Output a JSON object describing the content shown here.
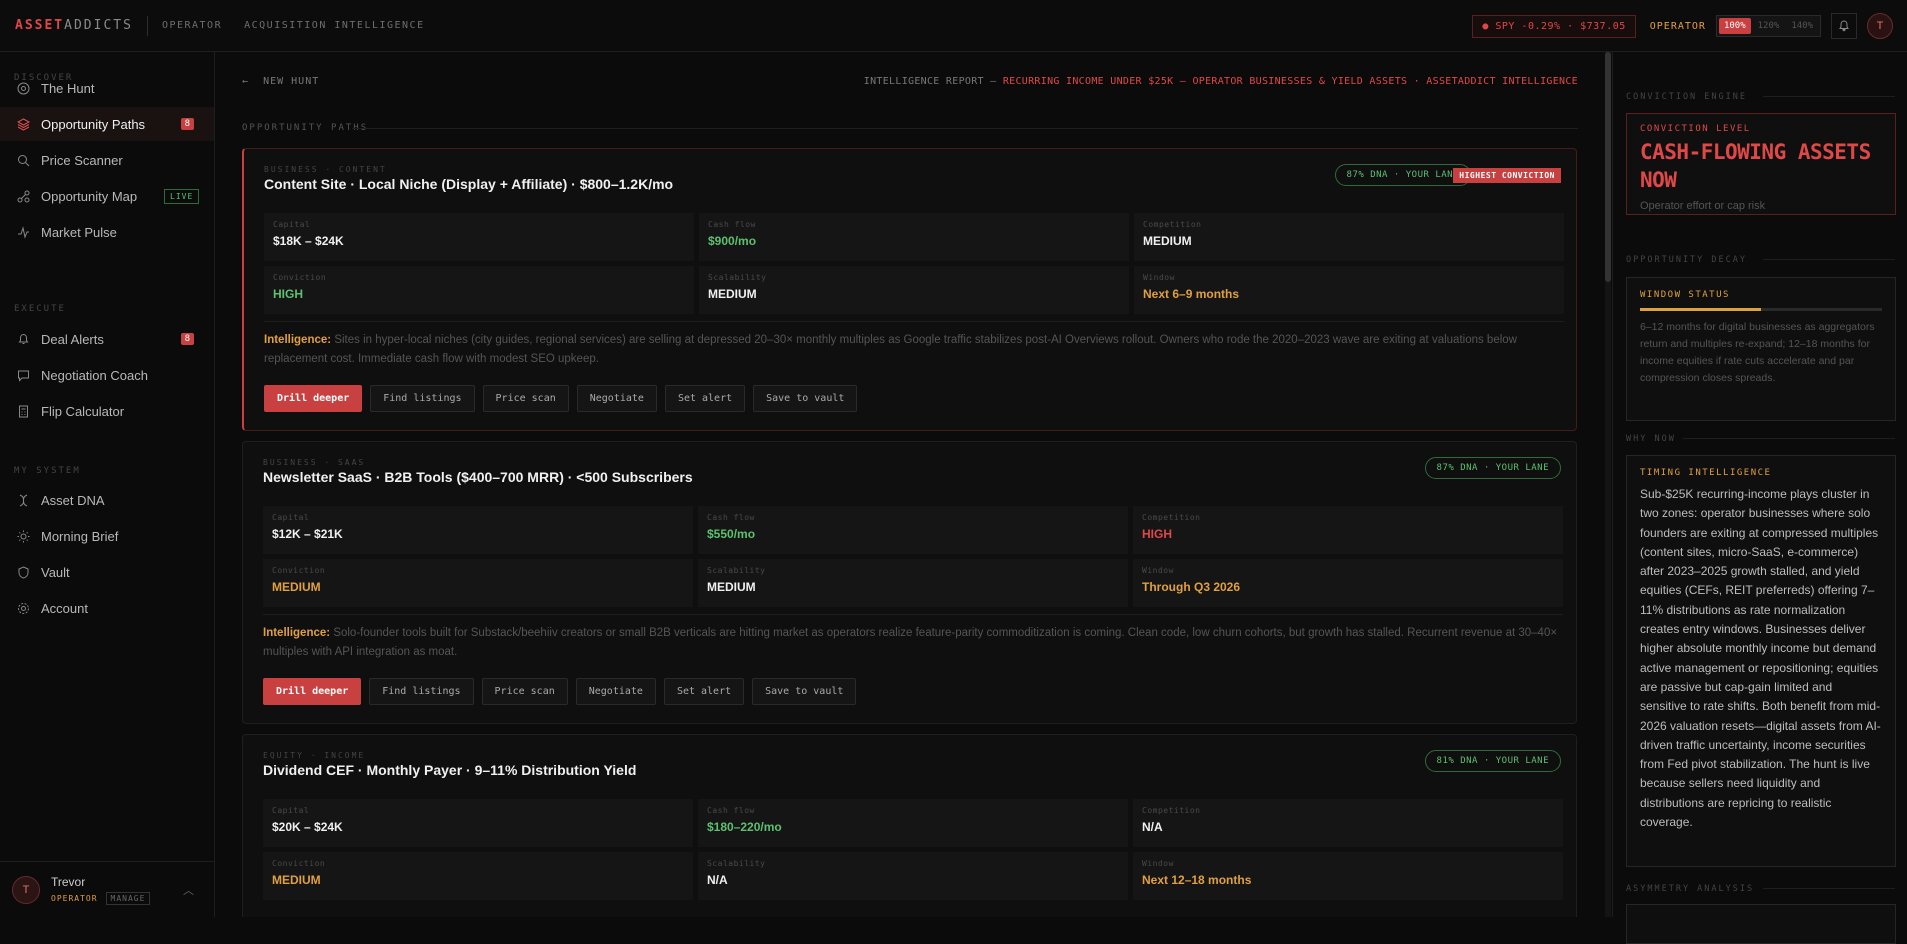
{
  "topbar": {
    "logo_a": "ASSET",
    "logo_b": "ADDICTS",
    "crumb1": "OPERATOR",
    "crumb2": "ACQUISITION INTELLIGENCE",
    "ticker": "● SPY -0.29% · $737.05",
    "mode": "OPERATOR",
    "zoom": [
      "100%",
      "120%",
      "140%"
    ],
    "zoom_selected": "100%",
    "avatar": "T"
  },
  "sidebar": {
    "group_discover": "DISCOVER",
    "group_execute": "EXECUTE",
    "group_system": "MY SYSTEM",
    "items": [
      {
        "label": "The Hunt",
        "icon": "target-icon"
      },
      {
        "label": "Opportunity Paths",
        "icon": "layers-icon",
        "badge": "8"
      },
      {
        "label": "Price Scanner",
        "icon": "search-icon"
      },
      {
        "label": "Opportunity Map",
        "icon": "map-icon",
        "tag": "LIVE"
      },
      {
        "label": "Market Pulse",
        "icon": "pulse-icon"
      },
      {
        "label": "Deal Alerts",
        "icon": "bell-icon",
        "badge": "8"
      },
      {
        "label": "Negotiation Coach",
        "icon": "chat-icon"
      },
      {
        "label": "Flip Calculator",
        "icon": "calculator-icon"
      },
      {
        "label": "Asset DNA",
        "icon": "dna-icon"
      },
      {
        "label": "Morning Brief",
        "icon": "sun-icon"
      },
      {
        "label": "Vault",
        "icon": "shield-icon"
      },
      {
        "label": "Account",
        "icon": "gear-icon"
      }
    ],
    "user": {
      "initial": "T",
      "name": "Trevor",
      "role": "OPERATOR",
      "manage": "MANAGE"
    }
  },
  "main": {
    "back": "NEW HUNT",
    "report_prefix": "INTELLIGENCE REPORT — ",
    "report_title": "RECURRING INCOME UNDER $25K — OPERATOR BUSINESSES & YIELD ASSETS · ASSETADDICT INTELLIGENCE",
    "section": "OPPORTUNITY PATHS",
    "buttons": [
      "Drill deeper",
      "Find listings",
      "Price scan",
      "Negotiate",
      "Set alert",
      "Save to vault"
    ],
    "labels": {
      "capital": "Capital",
      "cashflow": "Cash flow",
      "competition": "Competition",
      "conviction": "Conviction",
      "scalability": "Scalability",
      "window": "Window",
      "intel": "Intelligence:"
    },
    "cards": [
      {
        "tag": "BUSINESS · CONTENT",
        "title": "Content Site · Local Niche (Display + Affiliate) · $800–1.2K/mo",
        "dna": "87% DNA · YOUR LANE",
        "badge": "HIGHEST CONVICTION",
        "capital": "$18K – $24K",
        "cashflow": "$900/mo",
        "competition": "MEDIUM",
        "conviction": "HIGH",
        "scalability": "MEDIUM",
        "window": "Next 6–9 months",
        "intel": "Sites in hyper-local niches (city guides, regional services) are selling at depressed 20–30× monthly multiples as Google traffic stabilizes post-AI Overviews rollout. Owners who rode the 2020–2023 wave are exiting at valuations below replacement cost. Immediate cash flow with modest SEO upkeep."
      },
      {
        "tag": "BUSINESS · SAAS",
        "title": "Newsletter SaaS · B2B Tools ($400–700 MRR) · <500 Subscribers",
        "dna": "87% DNA · YOUR LANE",
        "capital": "$12K – $21K",
        "cashflow": "$550/mo",
        "competition": "HIGH",
        "conviction": "MEDIUM",
        "scalability": "MEDIUM",
        "window": "Through Q3 2026",
        "intel": "Solo-founder tools built for Substack/beehiiv creators or small B2B verticals are hitting market as operators realize feature-parity commoditization is coming. Clean code, low churn cohorts, but growth has stalled. Recurrent revenue at 30–40× multiples with API integration as moat."
      },
      {
        "tag": "EQUITY · INCOME",
        "title": "Dividend CEF · Monthly Payer · 9–11% Distribution Yield",
        "dna": "81% DNA · YOUR LANE",
        "capital": "$20K – $24K",
        "cashflow": "$180–220/mo",
        "competition": "N/A",
        "conviction": "MEDIUM",
        "scalability": "N/A",
        "window": "Next 12–18 months"
      }
    ]
  },
  "rpanel": {
    "engine": "CONVICTION ENGINE",
    "conv_label": "CONVICTION LEVEL",
    "conv_line1": "CASH-FLOWING ASSETS",
    "conv_line2": "NOW",
    "conv_sub": "Operator effort or cap risk",
    "decay": "OPPORTUNITY DECAY",
    "window_label": "WINDOW STATUS",
    "window_progress": 0.5,
    "window_text": "6–12 months for digital businesses as aggregators return and multiples re-expand; 12–18 months for income equities if rate cuts accelerate and par compression closes spreads.",
    "why": "WHY NOW",
    "timing_label": "TIMING INTELLIGENCE",
    "timing_text": "Sub-$25K recurring-income plays cluster in two zones: operator businesses where solo founders are exiting at compressed multiples (content sites, micro-SaaS, e-commerce) after 2023–2025 growth stalled, and yield equities (CEFs, REIT preferreds) offering 7–11% distributions as rate normalization creates entry windows. Businesses deliver higher absolute monthly income but demand active management or repositioning; equities are passive but cap-gain limited and sensitive to rate shifts. Both benefit from mid-2026 valuation resets—digital assets from AI-driven traffic uncertainty, income securities from Fed pivot stabilization. The hunt is live because sellers need liquidity and distributions are repricing to realistic coverage.",
    "asym": "ASYMMETRY ANALYSIS"
  },
  "colors": {
    "accent": "#c84040",
    "green": "#5cc070",
    "amber": "#e0a040"
  }
}
